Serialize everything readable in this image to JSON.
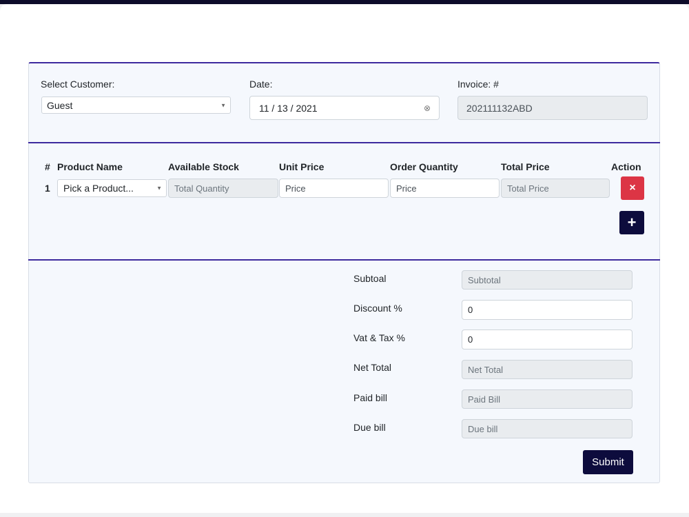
{
  "form": {
    "customer_label": "Select Customer:",
    "customer_value": "Guest",
    "date_label": "Date:",
    "date_value": "11 / 13 / 2021",
    "invoice_label": "Invoice: #",
    "invoice_value": "202111132ABD"
  },
  "table": {
    "headers": [
      "#",
      "Product Name",
      "Available Stock",
      "Unit Price",
      "Order Quantity",
      "Total Price",
      "Action"
    ],
    "rows": [
      {
        "index": "1",
        "product_placeholder": "Pick a Product...",
        "stock_placeholder": "Total Quantity",
        "unit_price_placeholder": "Price",
        "order_qty_placeholder": "Price",
        "total_price_placeholder": "Total Price"
      }
    ]
  },
  "summary": {
    "subtotal_label": "Subtoal",
    "subtotal_placeholder": "Subtotal",
    "discount_label": "Discount %",
    "discount_value": "0",
    "vat_label": "Vat & Tax %",
    "vat_value": "0",
    "net_label": "Net Total",
    "net_placeholder": "Net Total",
    "paid_label": "Paid bill",
    "paid_placeholder": "Paid Bill",
    "due_label": "Due bill",
    "due_placeholder": "Due bill"
  },
  "buttons": {
    "delete_icon": "×",
    "add_icon": "+",
    "submit_label": "Submit"
  },
  "icons": {
    "select_arrow": "▼",
    "clear_date": "⊗"
  },
  "colors": {
    "accent": "#3d2a9e",
    "danger": "#dc3545",
    "primary_dark": "#0d0c3d"
  }
}
